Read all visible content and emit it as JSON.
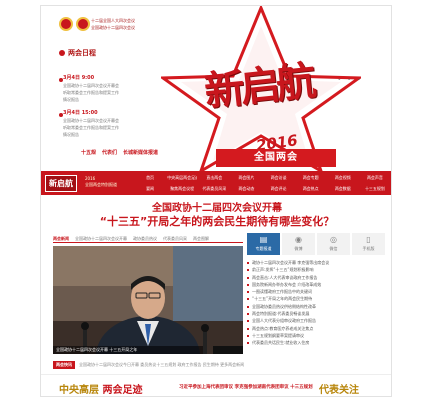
{
  "header": {
    "org_lines": [
      "十二届全国人大四次会议",
      "全国政协十二届四次会议"
    ],
    "schedule_title": "两会日程",
    "schedule": [
      {
        "time": "3月4日 9:00",
        "lines": [
          "全国政协十二届四次会议开幕会",
          "听取常委会工作报告和提案工作",
          "情况报告"
        ]
      },
      {
        "time": "3月4日 15:00",
        "lines": [
          "全国政协十二届四次会议开幕会",
          "听取常委会工作报告和提案工作",
          "情况报告"
        ]
      }
    ],
    "links": [
      "十五规",
      "代表们",
      "长城新媒体报道"
    ],
    "big_title": "新启航",
    "year": "2016",
    "band_label": "全国两会"
  },
  "nav": {
    "logo": "新启航",
    "sub": [
      "2016",
      "全国两会特别报道"
    ],
    "items": [
      "首页",
      "中央高层两会足迹",
      "直击两会",
      "两会图片",
      "两会访谈",
      "两会专题",
      "两会视频",
      "两会声音",
      "要闻",
      "聚焦两会议程",
      "代表委员风采",
      "两会动态",
      "两会评论",
      "两会热点",
      "两会数据",
      "十三五规划"
    ]
  },
  "headlines": {
    "h1": "全国政协十二届四次会议开幕",
    "h2": "“十三五”开局之年的两会民生期待有哪些变化？"
  },
  "tabs": [
    "两会新闻",
    "全国政协十二届四次会议开幕",
    "政协委员热议",
    "代表委员风采",
    "两会图解"
  ],
  "photo_caption": "全国政协十二届四次会议开幕 十三五开局之年",
  "right_panel": {
    "icons": [
      {
        "icon": "bookmark-icon",
        "label": "专题报道",
        "glyph": "▤"
      },
      {
        "icon": "weibo-icon",
        "label": "微博",
        "glyph": "◉"
      },
      {
        "icon": "wechat-icon",
        "label": "微信",
        "glyph": "◎"
      },
      {
        "icon": "phone-icon",
        "label": "手机版",
        "glyph": "▯"
      }
    ],
    "news": [
      "政协十二届四次会议开幕 李克强等出席会议",
      "俞正声:发挥“十三五”规划积极影响",
      "两会直击:人大代表审议政府工作报告",
      "国务院新闻办举办发布会 介绍改革成效",
      "一图读懂政府工作报告中的关键词",
      "“十三五”开局之年的两会民生期待",
      "全国政协委员热议供给侧结构性改革",
      "两会特别报道:代表委员畅谈发展",
      "全国人大代表分组审议政府工作报告",
      "两会热点:教育医疗养老成关注焦点",
      "十三五规划纲要草案提请审议",
      "代表委员共话民生:就业收入住房"
    ]
  },
  "ticker": {
    "tag": "两会快讯",
    "text": "全国政协十二届四次会议今日开幕 委员热议十三五规划 政府工作报告 民生期待 更多两会新闻"
  },
  "bottom": {
    "left_gold": "中央高层",
    "left_red": "两会足迹",
    "mid": [
      "习近平参加上海代表团审议",
      "李克强参加湖南代表团审议",
      "十三五规划"
    ],
    "right": "代表关注"
  },
  "colors": {
    "accent": "#c8161d",
    "gold": "#b8860b",
    "nav_blue": "#2b6aa6"
  }
}
